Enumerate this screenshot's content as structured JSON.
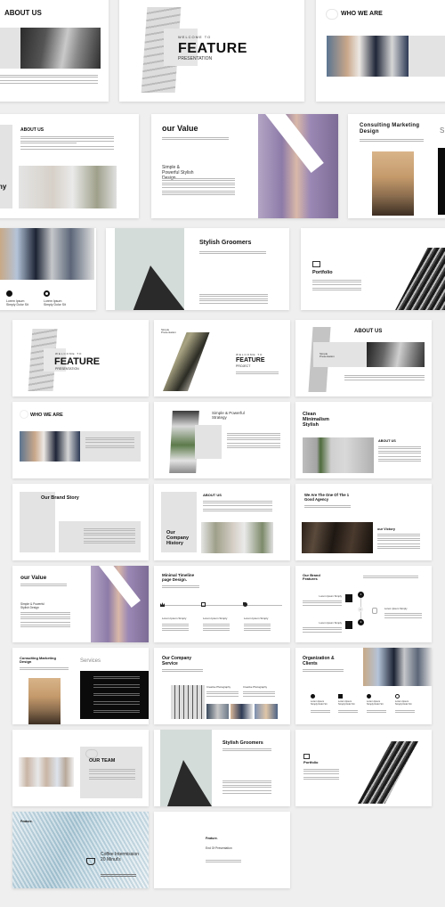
{
  "theme": {
    "background": "#efefef",
    "slide": "#ffffff",
    "panel_gray": "#e3e3e3",
    "text": "#111111",
    "lavender": "#9b8ab5",
    "dark": "#0b0b0b"
  },
  "row1": {
    "about_us": {
      "title": "ABOUT US"
    },
    "feature": {
      "welcome": "WELCOME TO",
      "title": "FEATURE",
      "subtitle": "PRESENTATION"
    },
    "who_we_are": {
      "title": "WHO WE ARE"
    }
  },
  "row2": {
    "about_us": {
      "title": "ABOUT US",
      "side_text": "ny"
    },
    "our_value": {
      "title": "our Value",
      "subtitle": "Simple & Powerful Stylish Design"
    },
    "consulting": {
      "title": "Consulting Marketing Design",
      "side_text": "S"
    }
  },
  "row3": {
    "clients": {
      "items": [
        {
          "label": "Lorem Ipsum Simply Dolor Sit"
        },
        {
          "label": "Lorem Ipsum Simply Dolor Sit"
        }
      ]
    },
    "groomers": {
      "title": "Stylish Groomers"
    },
    "portfolio": {
      "title": "Portfolio"
    }
  },
  "grid": {
    "s1": {
      "welcome": "WELCOME TO",
      "title": "FEATURE",
      "subtitle": "PRESENTATION"
    },
    "s2": {
      "tag": "Simple Presentation",
      "welcome": "WELCOME TO",
      "title": "FEATURE",
      "subtitle": "PROJECT"
    },
    "s3": {
      "title": "ABOUT US",
      "tag": "Simple Presentation"
    },
    "s4": {
      "title": "WHO WE ARE"
    },
    "s5": {
      "title": "Simple & Powerful Strategy"
    },
    "s6": {
      "title": "Clean Minimalism Stylish",
      "subtitle": "ABOUT US"
    },
    "s7": {
      "title": "Our Brand Story"
    },
    "s8": {
      "title": "Our Company History",
      "subtitle": "ABOUT US"
    },
    "s9": {
      "title": "We Are The One Of The 1 Good Agency",
      "subtitle": "our Victory"
    },
    "s10": {
      "title": "our Value",
      "subtitle": "Simple & Powerful Stylish Design"
    },
    "s11": {
      "title": "Minimal Timeline page Design.",
      "items": [
        "Lorem Ipsum Simply",
        "Lorem Ipsum Simply",
        "Lorem Ipsum Simply"
      ]
    },
    "s12": {
      "title": "Our Brand Features",
      "items": [
        "Lorem Ipsum Simply",
        "Lorem Ipsum Simply",
        "Lorem Ipsum Simply"
      ],
      "steps": [
        "1",
        "2",
        "3"
      ]
    },
    "s13": {
      "title": "Consulting Marketing Design",
      "services": "Services"
    },
    "s14": {
      "title": "Our Company Service",
      "items": [
        "Creative Photography",
        "Creative Photography"
      ]
    },
    "s15": {
      "title": "Organization & Clients",
      "items": [
        "Lorem Ipsum Simply Dolor Sit",
        "Lorem Ipsum Simply Dolor Sit",
        "Lorem Ipsum Simply Dolor Sit",
        "Lorem Ipsum Simply Dolor Sit"
      ]
    },
    "s16": {
      "title": "OUR TEAM"
    },
    "s17": {
      "title": "Stylish Groomers"
    },
    "s18": {
      "title": "Portfolio"
    },
    "s19": {
      "brand": "Feature.",
      "title": "Coffee Intermission 20 Minut's"
    },
    "s20": {
      "brand": "Feature.",
      "title": "End Of Presentation"
    }
  }
}
